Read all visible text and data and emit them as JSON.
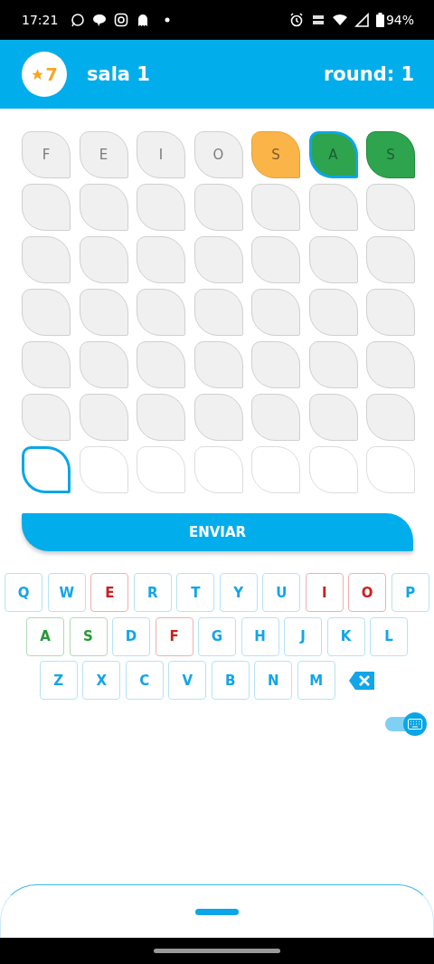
{
  "status_bar": {
    "time": "17:21",
    "battery": "94%"
  },
  "header": {
    "score": "7",
    "title": "sala 1",
    "round": "round: 1"
  },
  "board": [
    {
      "tiles": [
        {
          "letter": "F",
          "kind": "absent",
          "selected": false
        },
        {
          "letter": "E",
          "kind": "absent",
          "selected": false
        },
        {
          "letter": "I",
          "kind": "absent",
          "selected": false
        },
        {
          "letter": "O",
          "kind": "absent",
          "selected": false
        },
        {
          "letter": "S",
          "kind": "present",
          "selected": false
        },
        {
          "letter": "A",
          "kind": "correct",
          "selected": true
        },
        {
          "letter": "S",
          "kind": "correct",
          "selected": false
        }
      ]
    },
    {
      "tiles": [
        {
          "kind": "filled",
          "selected": false
        },
        {
          "kind": "filled",
          "selected": false
        },
        {
          "kind": "filled",
          "selected": false
        },
        {
          "kind": "filled",
          "selected": false
        },
        {
          "kind": "filled",
          "selected": false
        },
        {
          "kind": "filled",
          "selected": false
        },
        {
          "kind": "filled",
          "selected": false
        }
      ]
    },
    {
      "tiles": [
        {
          "kind": "filled",
          "selected": false
        },
        {
          "kind": "filled",
          "selected": false
        },
        {
          "kind": "filled",
          "selected": false
        },
        {
          "kind": "filled",
          "selected": false
        },
        {
          "kind": "filled",
          "selected": false
        },
        {
          "kind": "filled",
          "selected": false
        },
        {
          "kind": "filled",
          "selected": false
        }
      ]
    },
    {
      "tiles": [
        {
          "kind": "filled",
          "selected": false
        },
        {
          "kind": "filled",
          "selected": false
        },
        {
          "kind": "filled",
          "selected": false
        },
        {
          "kind": "filled",
          "selected": false
        },
        {
          "kind": "filled",
          "selected": false
        },
        {
          "kind": "filled",
          "selected": false
        },
        {
          "kind": "filled",
          "selected": false
        }
      ]
    },
    {
      "tiles": [
        {
          "kind": "filled",
          "selected": false
        },
        {
          "kind": "filled",
          "selected": false
        },
        {
          "kind": "filled",
          "selected": false
        },
        {
          "kind": "filled",
          "selected": false
        },
        {
          "kind": "filled",
          "selected": false
        },
        {
          "kind": "filled",
          "selected": false
        },
        {
          "kind": "filled",
          "selected": false
        }
      ]
    },
    {
      "tiles": [
        {
          "kind": "filled",
          "selected": false
        },
        {
          "kind": "filled",
          "selected": false
        },
        {
          "kind": "filled",
          "selected": false
        },
        {
          "kind": "filled",
          "selected": false
        },
        {
          "kind": "filled",
          "selected": false
        },
        {
          "kind": "filled",
          "selected": false
        },
        {
          "kind": "filled",
          "selected": false
        }
      ]
    },
    {
      "tiles": [
        {
          "kind": "empty",
          "selected": true
        },
        {
          "kind": "empty",
          "selected": false
        },
        {
          "kind": "empty",
          "selected": false
        },
        {
          "kind": "empty",
          "selected": false
        },
        {
          "kind": "empty",
          "selected": false
        },
        {
          "kind": "empty",
          "selected": false
        },
        {
          "kind": "empty",
          "selected": false
        }
      ]
    }
  ],
  "submit_button": "ENVIAR",
  "keyboard": [
    [
      {
        "key": "Q",
        "kind": "unused"
      },
      {
        "key": "W",
        "kind": "unused"
      },
      {
        "key": "E",
        "kind": "absent"
      },
      {
        "key": "R",
        "kind": "unused"
      },
      {
        "key": "T",
        "kind": "unused"
      },
      {
        "key": "Y",
        "kind": "unused"
      },
      {
        "key": "U",
        "kind": "unused"
      },
      {
        "key": "I",
        "kind": "absent"
      },
      {
        "key": "O",
        "kind": "absent"
      },
      {
        "key": "P",
        "kind": "unused"
      }
    ],
    [
      {
        "key": "A",
        "kind": "correct"
      },
      {
        "key": "S",
        "kind": "correct"
      },
      {
        "key": "D",
        "kind": "unused"
      },
      {
        "key": "F",
        "kind": "absent"
      },
      {
        "key": "G",
        "kind": "unused"
      },
      {
        "key": "H",
        "kind": "unused"
      },
      {
        "key": "J",
        "kind": "unused"
      },
      {
        "key": "K",
        "kind": "unused"
      },
      {
        "key": "L",
        "kind": "unused"
      }
    ],
    [
      {
        "key": "Z",
        "kind": "unused"
      },
      {
        "key": "X",
        "kind": "unused"
      },
      {
        "key": "C",
        "kind": "unused"
      },
      {
        "key": "V",
        "kind": "unused"
      },
      {
        "key": "B",
        "kind": "unused"
      },
      {
        "key": "N",
        "kind": "unused"
      },
      {
        "key": "M",
        "kind": "unused"
      }
    ]
  ],
  "keyboard_toggle": {
    "on": true
  }
}
